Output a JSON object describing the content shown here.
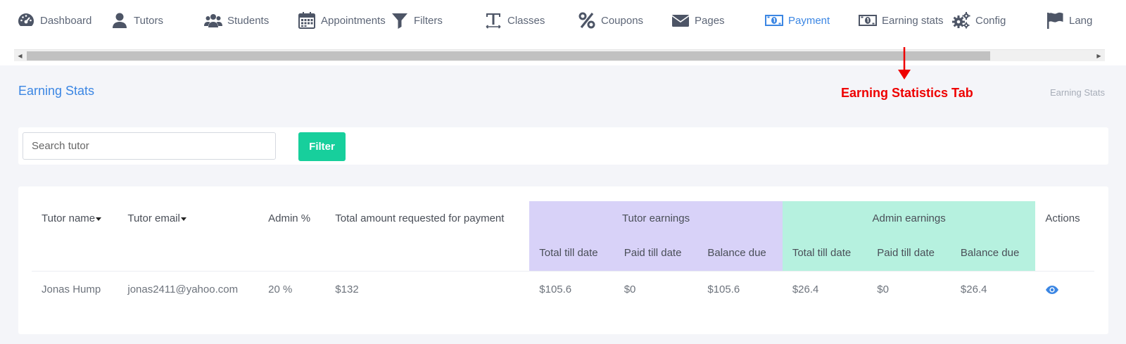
{
  "nav": {
    "items": [
      {
        "label": "Dashboard",
        "icon": "tachometer-icon"
      },
      {
        "label": "Tutors",
        "icon": "user-icon"
      },
      {
        "label": "Students",
        "icon": "users-icon"
      },
      {
        "label": "Appointments",
        "icon": "calendar-icon"
      },
      {
        "label": "Filters",
        "icon": "filter-icon"
      },
      {
        "label": "Classes",
        "icon": "text-icon"
      },
      {
        "label": "Coupons",
        "icon": "percent-icon"
      },
      {
        "label": "Pages",
        "icon": "envelope-icon"
      },
      {
        "label": "Payment",
        "icon": "money-icon",
        "active": true
      },
      {
        "label": "Earning stats",
        "icon": "money-icon"
      },
      {
        "label": "Config",
        "icon": "gears-icon"
      },
      {
        "label": "Lang",
        "icon": "flag-icon"
      }
    ],
    "active_color": "#3b86e3"
  },
  "page": {
    "title": "Earning Stats",
    "breadcrumb": "Earning Stats"
  },
  "annotation": {
    "label": "Earning Statistics Tab",
    "color": "#ee0000"
  },
  "filter": {
    "search_placeholder": "Search tutor",
    "button_label": "Filter",
    "button_color": "#17cf9c"
  },
  "table": {
    "headers": {
      "tutor_name": "Tutor name",
      "tutor_email": "Tutor email",
      "admin_percent": "Admin %",
      "total_requested": "Total amount requested for payment",
      "tutor_earnings": "Tutor earnings",
      "admin_earnings": "Admin earnings",
      "actions": "Actions",
      "sub": [
        "Total till date",
        "Paid till date",
        "Balance due",
        "Total till date",
        "Paid till date",
        "Balance due"
      ]
    },
    "tutor_group_color": "#d8d2f8",
    "admin_group_color": "#b6f1df",
    "rows": [
      {
        "tutor_name": "Jonas Hump",
        "tutor_email": "jonas2411@yahoo.com",
        "admin_percent": "20 %",
        "total_requested": "$132",
        "tutor_total": "$105.6",
        "tutor_paid": "$0",
        "tutor_balance": "$105.6",
        "admin_total": "$26.4",
        "admin_paid": "$0",
        "admin_balance": "$26.4",
        "action_icon": "eye-icon"
      }
    ]
  }
}
